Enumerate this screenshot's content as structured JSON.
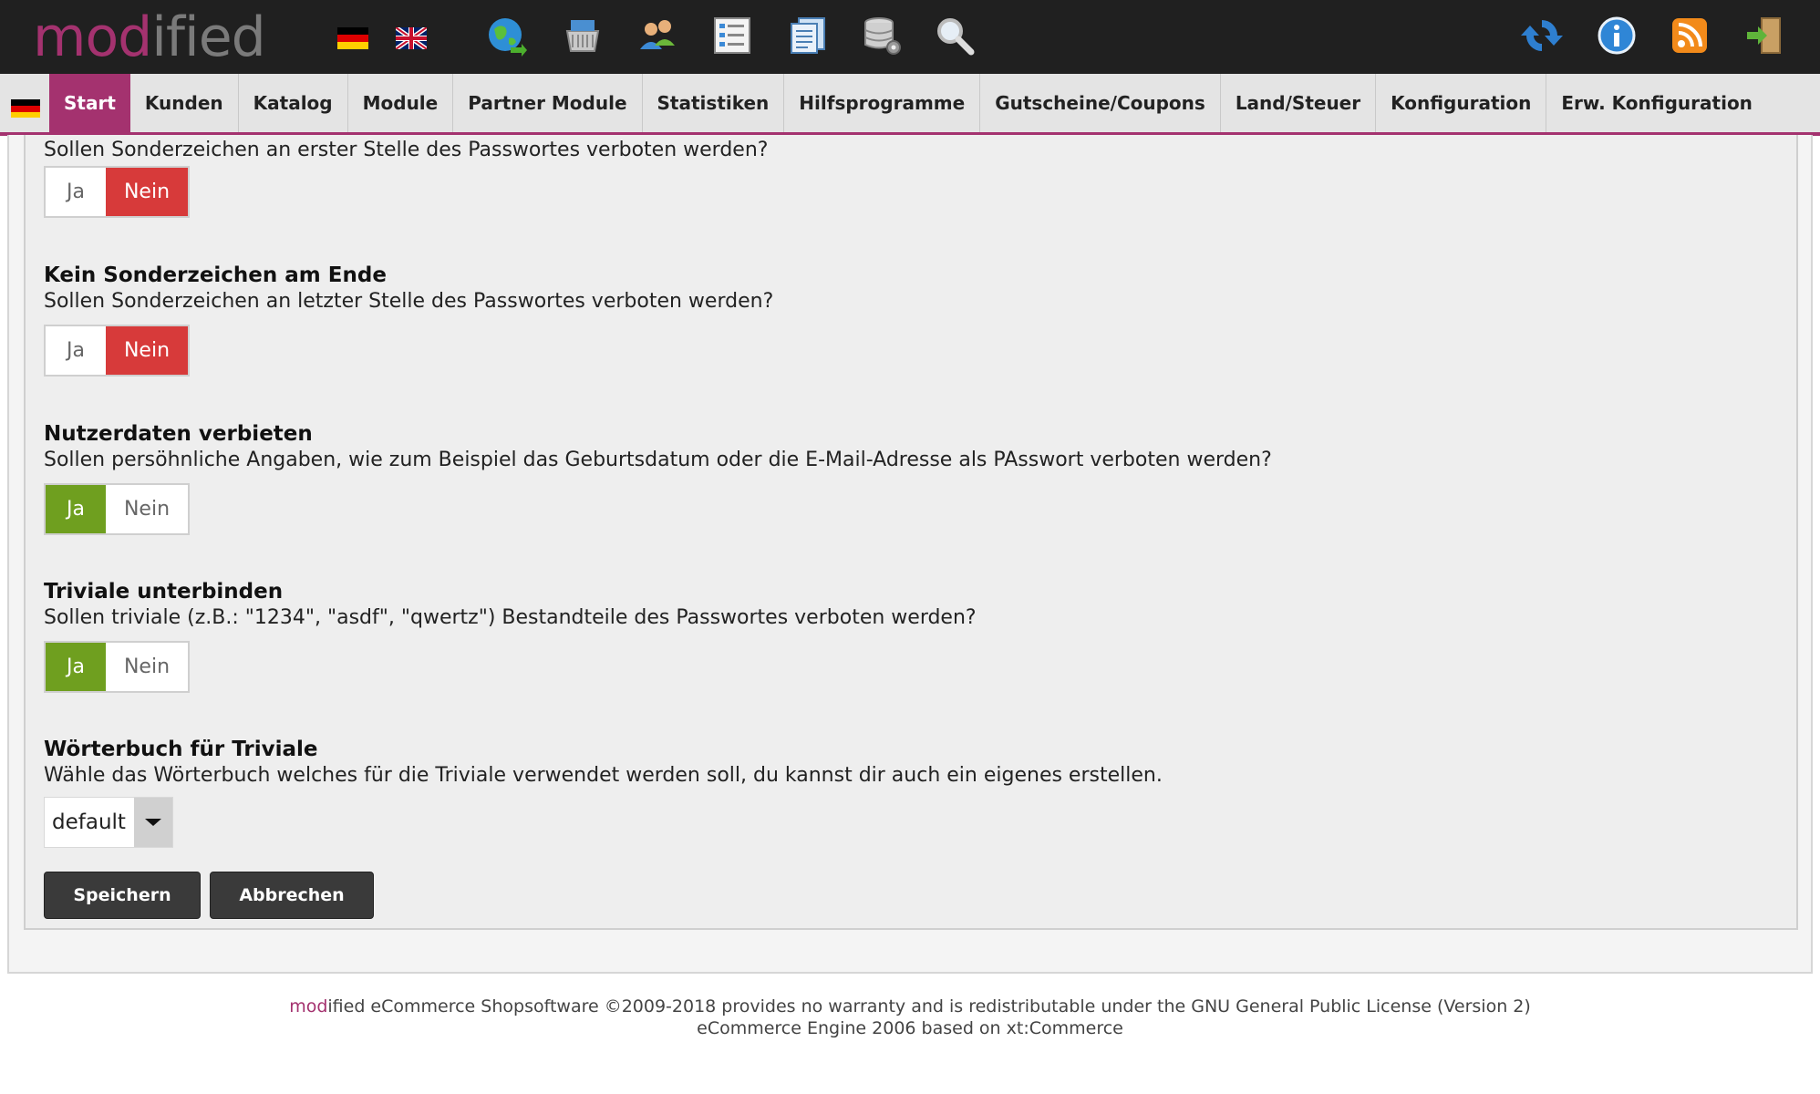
{
  "header": {
    "logo_part1": "mod",
    "logo_part2": "ified",
    "icons_left": [
      "globe-icon",
      "basket-icon",
      "customers-icon",
      "list-icon",
      "documents-icon",
      "database-icon",
      "search-icon"
    ],
    "icons_right": [
      "refresh-icon",
      "info-icon",
      "rss-icon",
      "logout-icon"
    ],
    "languages": [
      "de",
      "en"
    ]
  },
  "nav": {
    "items": [
      {
        "label": "Start"
      },
      {
        "label": "Kunden"
      },
      {
        "label": "Katalog"
      },
      {
        "label": "Module"
      },
      {
        "label": "Partner Module"
      },
      {
        "label": "Statistiken"
      },
      {
        "label": "Hilfsprogramme"
      },
      {
        "label": "Gutscheine/Coupons"
      },
      {
        "label": "Land/Steuer"
      },
      {
        "label": "Konfiguration"
      },
      {
        "label": "Erw. Konfiguration"
      }
    ]
  },
  "fields": [
    {
      "title": "",
      "description": "Sollen Sonderzeichen an erster Stelle des Passwortes verboten werden?",
      "selected": "Nein"
    },
    {
      "title": "Kein Sonderzeichen am Ende",
      "description": "Sollen Sonderzeichen an letzter Stelle des Passwortes verboten werden?",
      "selected": "Nein"
    },
    {
      "title": "Nutzerdaten verbieten",
      "description": "Sollen persöhnliche Angaben, wie zum Beispiel das Geburtsdatum oder die E-Mail-Adresse als PAsswort verboten werden?",
      "selected": "Ja"
    },
    {
      "title": "Triviale unterbinden",
      "description": "Sollen triviale (z.B.: \"1234\", \"asdf\", \"qwertz\") Bestandteile des Passwortes verboten werden?",
      "selected": "Ja"
    },
    {
      "title": "Wörterbuch für Triviale",
      "description": "Wähle das Wörterbuch welches für die Triviale verwendet werden soll, du kannst dir auch ein eigenes erstellen.",
      "select_value": "default"
    }
  ],
  "toggle_labels": {
    "yes": "Ja",
    "no": "Nein"
  },
  "buttons": {
    "save": "Speichern",
    "cancel": "Abbrechen"
  },
  "footer": {
    "brand_mod": "mod",
    "line1_rest": "ified eCommerce Shopsoftware ©2009-2018 provides no warranty and is redistributable under the GNU General Public License (Version 2)",
    "line2": "eCommerce Engine 2006 based on xt:Commerce"
  },
  "colors": {
    "brand": "#a4326f",
    "yes_active": "#6f9f1f",
    "no_active": "#d73a3a",
    "header_bg": "#202020"
  }
}
